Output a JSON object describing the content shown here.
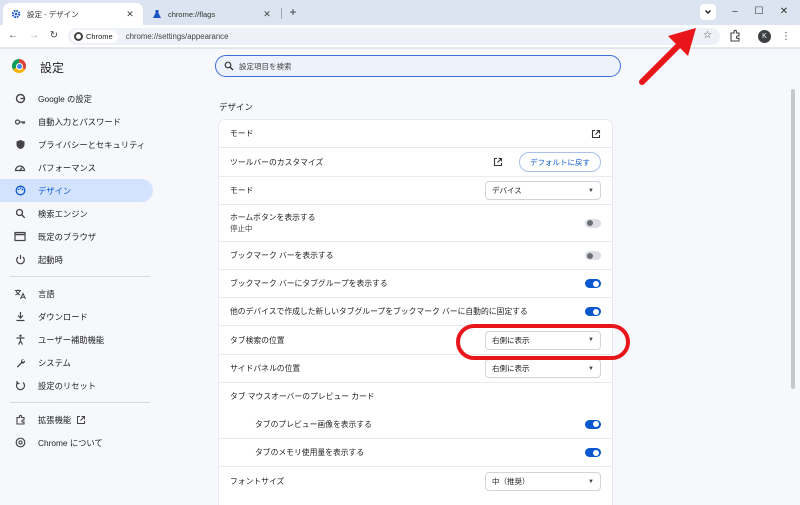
{
  "tabs": [
    {
      "label": "設定 - デザイン",
      "icon": "gear-icon",
      "active": true
    },
    {
      "label": "chrome://flags",
      "icon": "flask-icon",
      "active": false
    }
  ],
  "toolbar": {
    "chip_label": "Chrome",
    "url": "chrome://settings/appearance",
    "profile_initial": "K"
  },
  "page": {
    "title": "設定",
    "search_placeholder": "設定項目を検索"
  },
  "sidebar": {
    "items": [
      {
        "label": "Google の設定",
        "icon": "google-icon"
      },
      {
        "label": "自動入力とパスワード",
        "icon": "key-icon"
      },
      {
        "label": "プライバシーとセキュリティ",
        "icon": "shield-icon"
      },
      {
        "label": "パフォーマンス",
        "icon": "speedometer-icon"
      },
      {
        "label": "デザイン",
        "icon": "palette-icon",
        "active": true
      },
      {
        "label": "検索エンジン",
        "icon": "search-icon"
      },
      {
        "label": "既定のブラウザ",
        "icon": "browser-icon"
      },
      {
        "label": "起動時",
        "icon": "power-icon"
      },
      {
        "label": "言語",
        "icon": "translate-icon"
      },
      {
        "label": "ダウンロード",
        "icon": "download-icon"
      },
      {
        "label": "ユーザー補助機能",
        "icon": "accessibility-icon"
      },
      {
        "label": "システム",
        "icon": "wrench-icon"
      },
      {
        "label": "設定のリセット",
        "icon": "reset-icon"
      },
      {
        "label": "拡張機能",
        "icon": "puzzle-icon"
      },
      {
        "label": "Chrome について",
        "icon": "chrome-icon"
      }
    ]
  },
  "section": {
    "title": "デザイン"
  },
  "settings": {
    "mode_link": "モード",
    "toolbar_customize": "ツールバーのカスタマイズ",
    "reset_default": "デフォルトに戻す",
    "mode": {
      "label": "モード",
      "value": "デバイス"
    },
    "home_button": {
      "label": "ホームボタンを表示する",
      "sub": "停止中",
      "on": false
    },
    "bookmark_bar": {
      "label": "ブックマーク バーを表示する",
      "on": false
    },
    "tab_groups_bookmark": {
      "label": "ブックマーク バーにタブグループを表示する",
      "on": true
    },
    "auto_pin_groups": {
      "label": "他のデバイスで作成した新しいタブグループをブックマーク バーに自動的に固定する",
      "on": true
    },
    "tab_search_position": {
      "label": "タブ検索の位置",
      "value": "右側に表示"
    },
    "side_panel_position": {
      "label": "サイドパネルの位置",
      "value": "右側に表示"
    },
    "hover_card": {
      "label": "タブ マウスオーバーのプレビュー カード"
    },
    "preview_image": {
      "label": "タブのプレビュー画像を表示する",
      "on": true
    },
    "memory_usage": {
      "label": "タブのメモリ使用量を表示する",
      "on": true
    },
    "font_size": {
      "label": "フォントサイズ",
      "value": "中（推奨）"
    }
  },
  "colors": {
    "accent": "#0b57d0",
    "highlight": "#e8161b",
    "active_nav_bg": "#d3e3fd"
  }
}
